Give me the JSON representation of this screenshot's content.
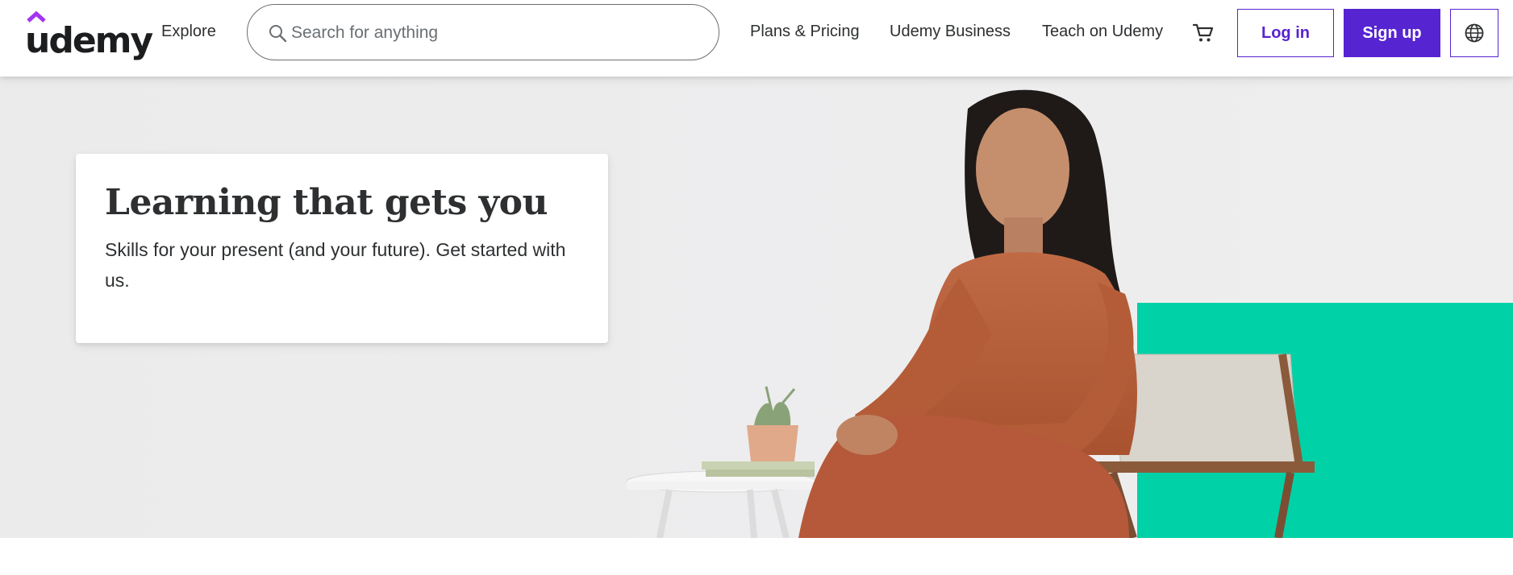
{
  "header": {
    "logo_text": "udemy",
    "explore_label": "Explore",
    "search": {
      "placeholder": "Search for anything",
      "value": ""
    },
    "nav_links": [
      "Plans & Pricing",
      "Udemy Business",
      "Teach on Udemy"
    ],
    "login_label": "Log in",
    "signup_label": "Sign up",
    "icons": {
      "search": "search-icon",
      "cart": "cart-icon",
      "language": "globe-icon"
    }
  },
  "hero": {
    "title": "Learning that gets you",
    "subtitle": "Skills for your present (and your future). Get started with us."
  },
  "colors": {
    "brand_purple": "#5624d0",
    "logo_accent": "#a435f0",
    "hero_bg": "#ecebec",
    "hero_accent_teal": "#00d1a7",
    "text": "#2d2f31"
  }
}
